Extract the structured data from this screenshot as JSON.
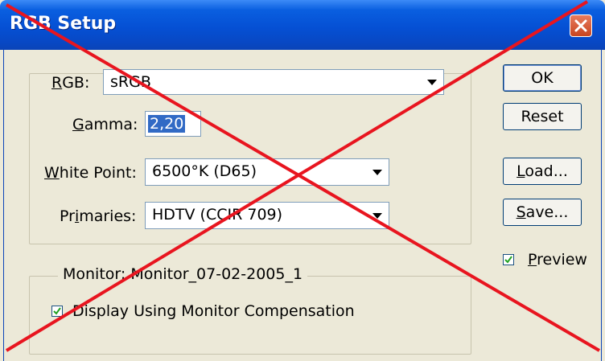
{
  "window": {
    "title": "RGB Setup"
  },
  "rgb": {
    "label": "RGB:",
    "value": "sRGB"
  },
  "gamma": {
    "label": "Gamma:",
    "value": "2,20"
  },
  "white_point": {
    "label": "White Point:",
    "value": "6500°K (D65)"
  },
  "primaries": {
    "label": "Primaries:",
    "value": "HDTV (CCIR 709)"
  },
  "monitor": {
    "legend": "Monitor: Monitor_07-02-2005_1",
    "compensation_label": "Display Using Monitor Compensation",
    "compensation_checked": true
  },
  "buttons": {
    "ok": "OK",
    "reset": "Reset",
    "load": "Load...",
    "save": "Save..."
  },
  "preview": {
    "label": "Preview",
    "checked": true
  },
  "colors": {
    "titlebar": "#0550d4",
    "cross": "#e8151f",
    "face": "#ECE9D8"
  }
}
